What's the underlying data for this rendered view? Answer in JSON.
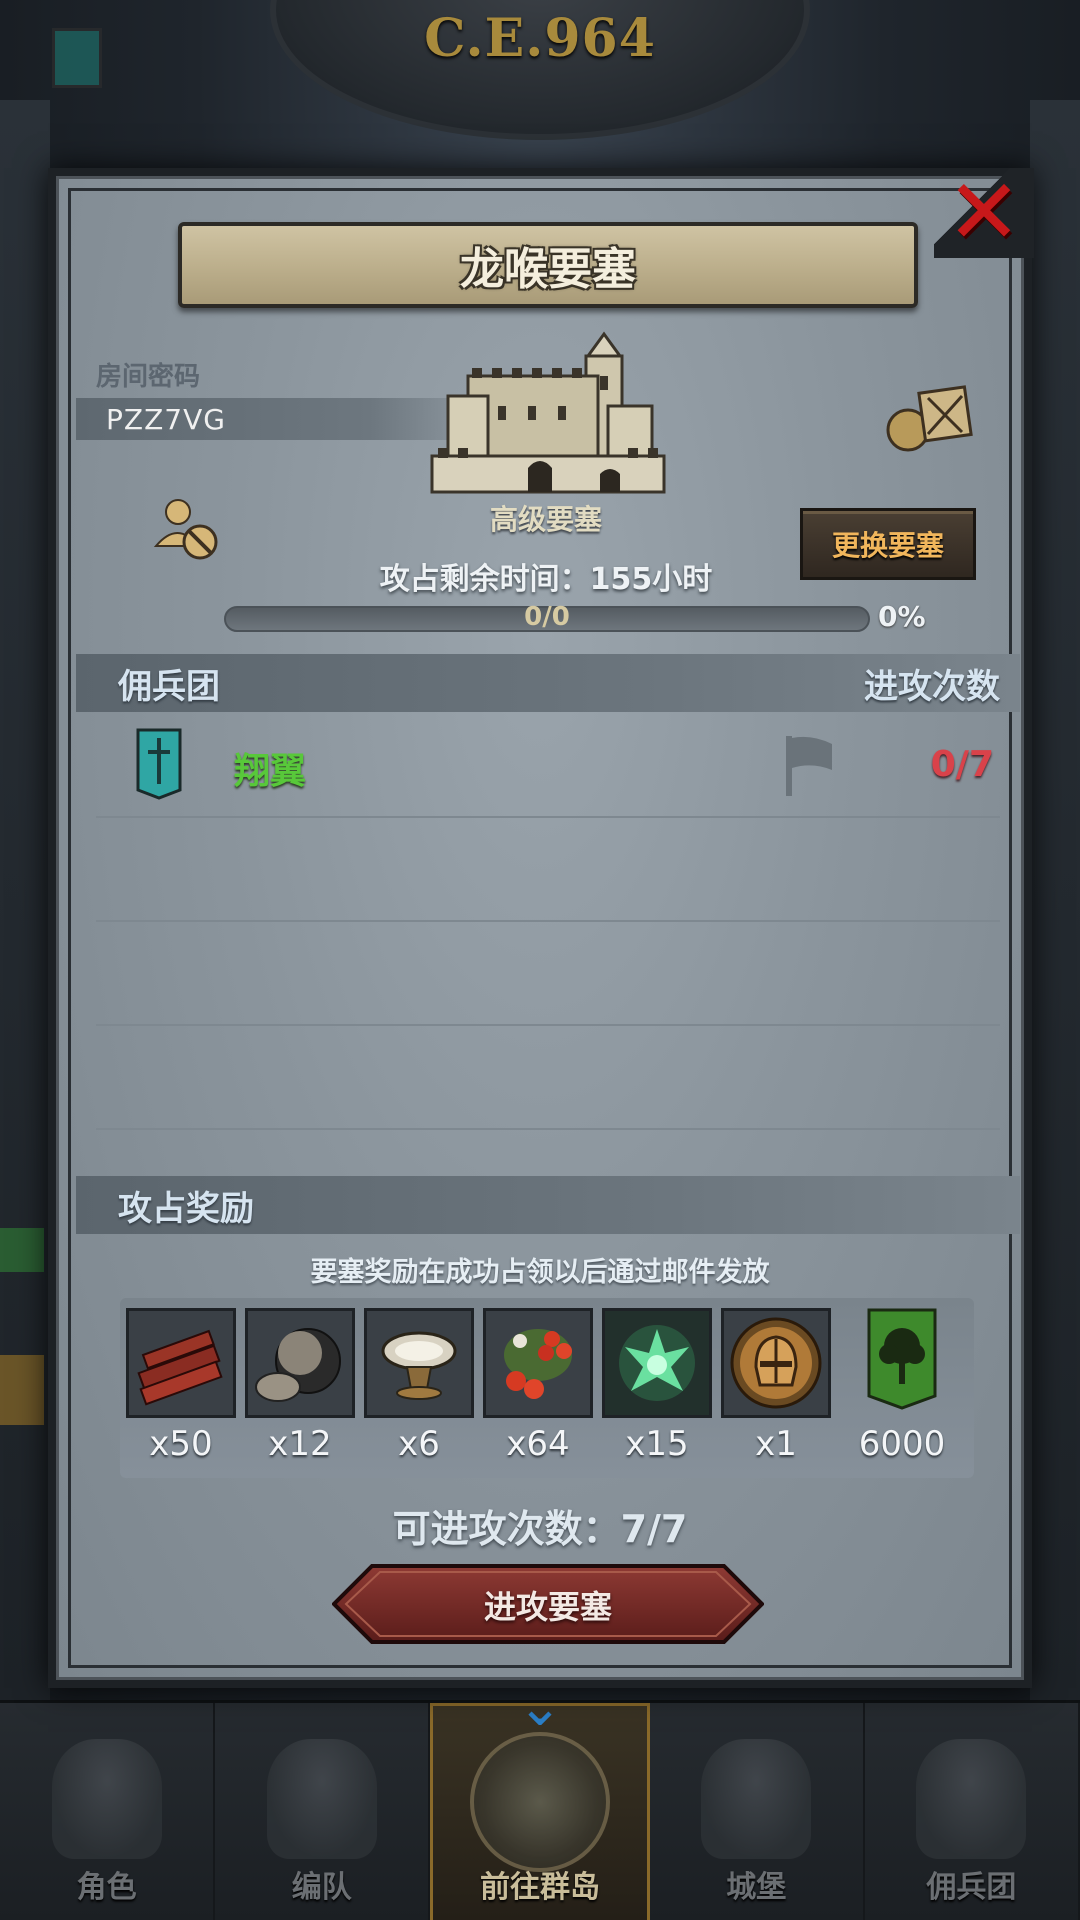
{
  "header": {
    "era": "C.E.964"
  },
  "modal": {
    "title": "龙喉要塞",
    "room_label": "房间密码",
    "room_code": "PZZ7VG",
    "fort_level": "高级要塞",
    "change_button": "更换要塞",
    "remaining_time": "攻占剩余时间：155小时",
    "progress": {
      "text": "0/0",
      "percent_label": "0%",
      "fraction": 0
    },
    "mercenary_section": {
      "left": "佣兵团",
      "right": "进攻次数"
    },
    "guilds": [
      {
        "name": "翔翼",
        "attacks": "0/7",
        "banner_color": "#2fa6a4"
      }
    ],
    "reward_section": {
      "title": "攻占奖励"
    },
    "reward_note": "要塞奖励在成功占领以后通过邮件发放",
    "rewards": [
      {
        "icon": "wood-logs-icon",
        "qty": "x50"
      },
      {
        "icon": "ore-rock-icon",
        "qty": "x12"
      },
      {
        "icon": "silver-bowl-icon",
        "qty": "x6"
      },
      {
        "icon": "red-berries-icon",
        "qty": "x64"
      },
      {
        "icon": "green-spirit-icon",
        "qty": "x15"
      },
      {
        "icon": "knight-helmet-icon",
        "qty": "x1"
      },
      {
        "icon": "tree-banner-icon",
        "qty": "6000"
      }
    ],
    "attacks_available": "可进攻次数：7/7",
    "attack_button": "进攻要塞"
  },
  "nav": {
    "items": [
      {
        "label": "角色"
      },
      {
        "label": "编队"
      },
      {
        "label": "前往群岛",
        "active": true
      },
      {
        "label": "城堡"
      },
      {
        "label": "佣兵团"
      }
    ]
  },
  "colors": {
    "accent_gold": "#f1b65c",
    "danger": "#d9424a",
    "guild_green": "#58c83a",
    "close_red": "#c7181a"
  }
}
